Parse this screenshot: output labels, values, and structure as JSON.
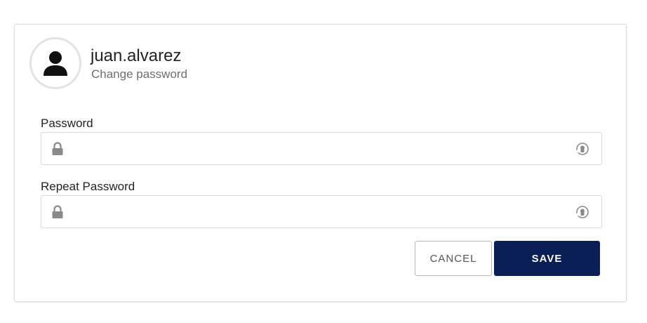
{
  "profile": {
    "username": "juan.alvarez",
    "subtitle": "Change password",
    "avatar_icon": "user-icon"
  },
  "form": {
    "password": {
      "label": "Password",
      "value": "",
      "placeholder": "",
      "left_icon": "lock-icon",
      "right_icon": "toggle-visibility-icon"
    },
    "repeat_password": {
      "label": "Repeat Password",
      "value": "",
      "placeholder": "",
      "left_icon": "lock-icon",
      "right_icon": "toggle-visibility-icon"
    }
  },
  "actions": {
    "cancel_label": "CANCEL",
    "save_label": "SAVE"
  },
  "colors": {
    "primary": "#0b1f57",
    "border": "#d9d9d9",
    "muted_text": "#6f6f6f",
    "icon": "#8a8a8a"
  }
}
